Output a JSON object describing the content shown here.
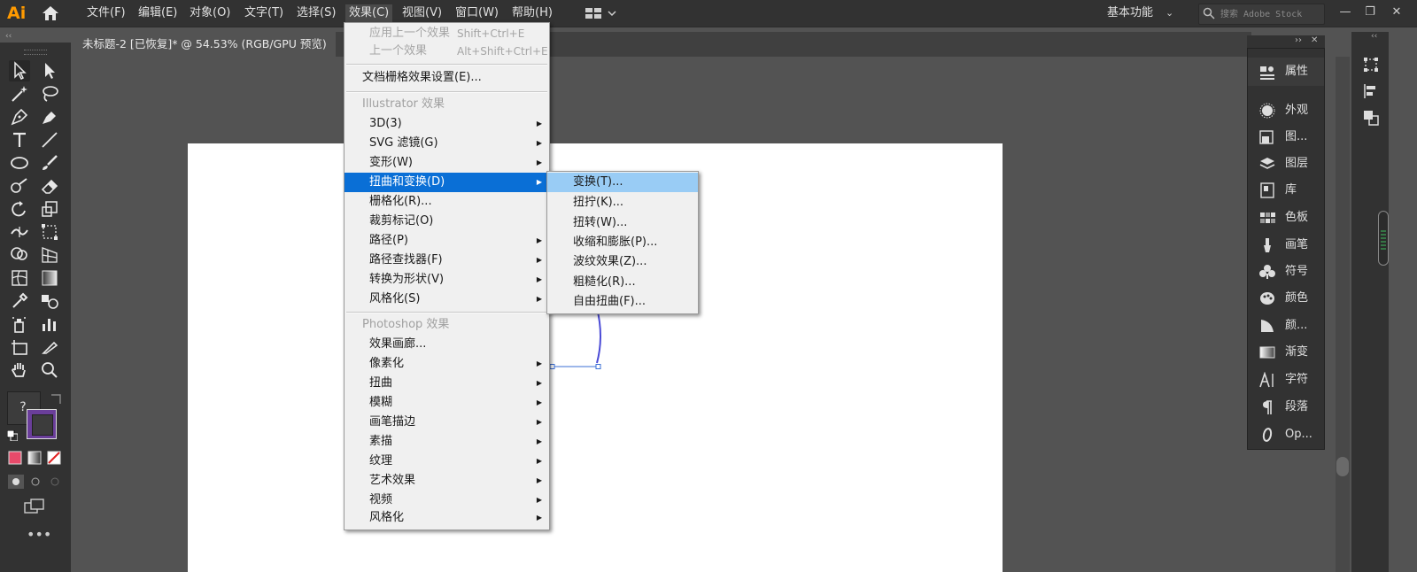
{
  "app": {
    "logo": "Ai"
  },
  "menubar": {
    "items": [
      {
        "label": "文件(F)"
      },
      {
        "label": "编辑(E)"
      },
      {
        "label": "对象(O)"
      },
      {
        "label": "文字(T)"
      },
      {
        "label": "选择(S)"
      },
      {
        "label": "效果(C)",
        "active": true
      },
      {
        "label": "视图(V)"
      },
      {
        "label": "窗口(W)"
      },
      {
        "label": "帮助(H)"
      }
    ],
    "workspace": "基本功能",
    "search_placeholder": "搜索 Adobe Stock"
  },
  "document": {
    "tab_title": "未标题-2 [已恢复]* @ 54.53% (RGB/GPU 预览)"
  },
  "toolbar": {
    "fill_label": "?"
  },
  "effect_menu": {
    "apply_last": {
      "label": "应用上一个效果",
      "shortcut": "Shift+Ctrl+E"
    },
    "last_effect": {
      "label": "上一个效果",
      "shortcut": "Alt+Shift+Ctrl+E"
    },
    "doc_raster_settings": "文档栅格效果设置(E)...",
    "illustrator_header": "Illustrator 效果",
    "illustrator_items": [
      {
        "label": "3D(3)",
        "submenu": true
      },
      {
        "label": "SVG 滤镜(G)",
        "submenu": true
      },
      {
        "label": "变形(W)",
        "submenu": true
      },
      {
        "label": "扭曲和变换(D)",
        "submenu": true,
        "highlighted": true
      },
      {
        "label": "栅格化(R)...",
        "submenu": false
      },
      {
        "label": "裁剪标记(O)",
        "submenu": false
      },
      {
        "label": "路径(P)",
        "submenu": true
      },
      {
        "label": "路径查找器(F)",
        "submenu": true
      },
      {
        "label": "转换为形状(V)",
        "submenu": true
      },
      {
        "label": "风格化(S)",
        "submenu": true
      }
    ],
    "photoshop_header": "Photoshop 效果",
    "photoshop_items": [
      {
        "label": "效果画廊...",
        "submenu": false
      },
      {
        "label": "像素化",
        "submenu": true
      },
      {
        "label": "扭曲",
        "submenu": true
      },
      {
        "label": "模糊",
        "submenu": true
      },
      {
        "label": "画笔描边",
        "submenu": true
      },
      {
        "label": "素描",
        "submenu": true
      },
      {
        "label": "纹理",
        "submenu": true
      },
      {
        "label": "艺术效果",
        "submenu": true
      },
      {
        "label": "视频",
        "submenu": true
      },
      {
        "label": "风格化",
        "submenu": true
      }
    ]
  },
  "distort_submenu": {
    "items": [
      {
        "label": "变换(T)...",
        "highlighted": true
      },
      {
        "label": "扭拧(K)..."
      },
      {
        "label": "扭转(W)..."
      },
      {
        "label": "收缩和膨胀(P)..."
      },
      {
        "label": "波纹效果(Z)..."
      },
      {
        "label": "粗糙化(R)..."
      },
      {
        "label": "自由扭曲(F)..."
      }
    ]
  },
  "right_panel": {
    "items": [
      {
        "label": "属性",
        "icon": "properties-icon"
      },
      {
        "label": "外观",
        "icon": "appearance-icon"
      },
      {
        "label": "图...",
        "icon": "graphic-styles-icon"
      },
      {
        "label": "图层",
        "icon": "layers-icon"
      },
      {
        "label": "库",
        "icon": "libraries-icon"
      },
      {
        "label": "色板",
        "icon": "swatches-icon"
      },
      {
        "label": "画笔",
        "icon": "brushes-icon"
      },
      {
        "label": "符号",
        "icon": "symbols-icon"
      },
      {
        "label": "颜色",
        "icon": "color-icon"
      },
      {
        "label": "颜...",
        "icon": "color-guide-icon"
      },
      {
        "label": "渐变",
        "icon": "gradient-icon"
      },
      {
        "label": "字符",
        "icon": "character-icon"
      },
      {
        "label": "段落",
        "icon": "paragraph-icon"
      },
      {
        "label": "Op...",
        "icon": "opentype-icon"
      }
    ]
  },
  "colors": {
    "accent": "#0a6fd6",
    "submenu_highlight": "#99ccf5",
    "stroke_swatch": "#6a3e9a",
    "logo": "#ff9a00"
  }
}
